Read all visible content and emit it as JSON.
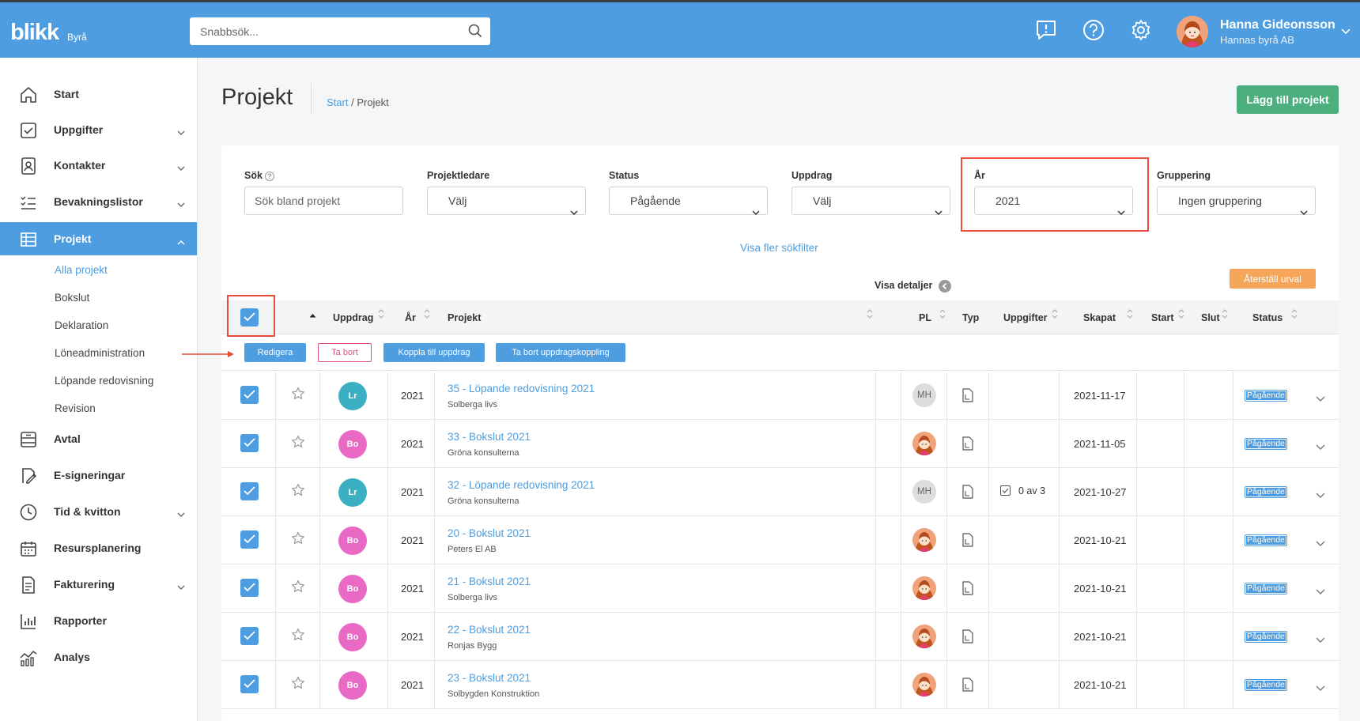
{
  "app": {
    "logo": "blikk",
    "logo_sub": "Byrå",
    "search_placeholder": "Snabbsök...",
    "user_name": "Hanna Gideonsson",
    "user_company": "Hannas byrå AB"
  },
  "sidebar": {
    "items": [
      {
        "label": "Start",
        "icon": "home-icon"
      },
      {
        "label": "Uppgifter",
        "icon": "checkbox-icon"
      },
      {
        "label": "Kontakter",
        "icon": "contacts-icon"
      },
      {
        "label": "Bevakningslistor",
        "icon": "list-icon"
      },
      {
        "label": "Projekt",
        "icon": "table-icon"
      },
      {
        "label": "Avtal",
        "icon": "archive-icon"
      },
      {
        "label": "E-signeringar",
        "icon": "signature-icon"
      },
      {
        "label": "Tid & kvitton",
        "icon": "clock-icon"
      },
      {
        "label": "Resursplanering",
        "icon": "calendar-icon"
      },
      {
        "label": "Fakturering",
        "icon": "invoice-icon"
      },
      {
        "label": "Rapporter",
        "icon": "bar-chart-icon"
      },
      {
        "label": "Analys",
        "icon": "analytics-icon"
      }
    ],
    "sub_items": [
      "Alla projekt",
      "Bokslut",
      "Deklaration",
      "Löneadministration",
      "Löpande redovisning",
      "Revision"
    ]
  },
  "page": {
    "title": "Projekt",
    "breadcrumb_start": "Start",
    "breadcrumb_sep": " / ",
    "breadcrumb_current": "Projekt",
    "add_button": "Lägg till projekt"
  },
  "filters": {
    "search_label": "Sök",
    "search_placeholder": "Sök bland projekt",
    "projektledare_label": "Projektledare",
    "projektledare_value": "Välj",
    "status_label": "Status",
    "status_value": "Pågående",
    "uppdrag_label": "Uppdrag",
    "uppdrag_value": "Välj",
    "year_label": "År",
    "year_value": "2021",
    "grouping_label": "Gruppering",
    "grouping_value": "Ingen gruppering",
    "more_filters": "Visa fler sökfilter",
    "show_details": "Visa detaljer",
    "reset": "Återställ urval"
  },
  "table": {
    "headers": {
      "uppdrag": "Uppdrag",
      "year": "År",
      "projekt": "Projekt",
      "pl": "PL",
      "typ": "Typ",
      "uppgifter": "Uppgifter",
      "skapat": "Skapat",
      "start": "Start",
      "slut": "Slut",
      "status": "Status"
    },
    "actions": {
      "edit": "Redigera",
      "delete": "Ta bort",
      "link": "Koppla till uppdrag",
      "unlink": "Ta bort uppdragskoppling"
    },
    "rows": [
      {
        "badge": "Lr",
        "badge_color": "#3bb0c2",
        "year": "2021",
        "title": "35 - Löpande redovisning 2021",
        "client": "Solberga livs",
        "pl": "MH",
        "tasks": "",
        "created": "2021-11-17",
        "status": "Pågående"
      },
      {
        "badge": "Bo",
        "badge_color": "#e96ac4",
        "year": "2021",
        "title": "33 - Bokslut 2021",
        "client": "Gröna konsulterna",
        "pl": "",
        "tasks": "",
        "created": "2021-11-05",
        "status": "Pågående"
      },
      {
        "badge": "Lr",
        "badge_color": "#3bb0c2",
        "year": "2021",
        "title": "32 - Löpande redovisning 2021",
        "client": "Gröna konsulterna",
        "pl": "MH",
        "tasks": "0 av 3",
        "created": "2021-10-27",
        "status": "Pågående"
      },
      {
        "badge": "Bo",
        "badge_color": "#e96ac4",
        "year": "2021",
        "title": "20 - Bokslut 2021",
        "client": "Peters El AB",
        "pl": "",
        "tasks": "",
        "created": "2021-10-21",
        "status": "Pågående"
      },
      {
        "badge": "Bo",
        "badge_color": "#e96ac4",
        "year": "2021",
        "title": "21 - Bokslut 2021",
        "client": "Solberga livs",
        "pl": "",
        "tasks": "",
        "created": "2021-10-21",
        "status": "Pågående"
      },
      {
        "badge": "Bo",
        "badge_color": "#e96ac4",
        "year": "2021",
        "title": "22 - Bokslut 2021",
        "client": "Ronjas Bygg",
        "pl": "",
        "tasks": "",
        "created": "2021-10-21",
        "status": "Pågående"
      },
      {
        "badge": "Bo",
        "badge_color": "#e96ac4",
        "year": "2021",
        "title": "23 - Bokslut 2021",
        "client": "Solbygden Konstruktion",
        "pl": "",
        "tasks": "",
        "created": "2021-10-21",
        "status": "Pågående"
      }
    ]
  },
  "colors": {
    "brand": "#4d9de0",
    "success": "#4caf7d",
    "warning": "#f5a65b",
    "highlight": "#e74c3c"
  }
}
